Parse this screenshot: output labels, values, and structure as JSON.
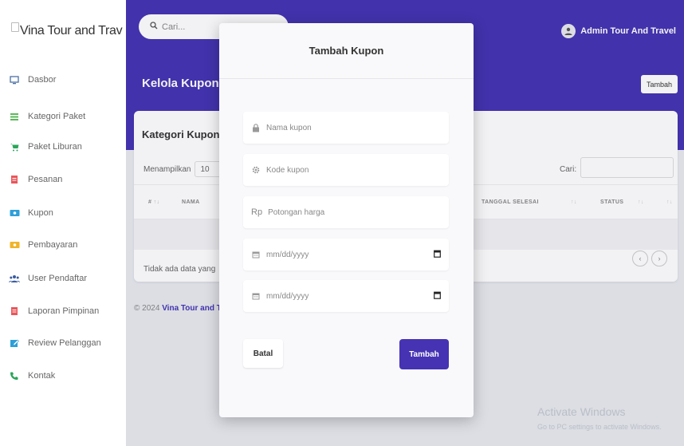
{
  "brand": {
    "name": "Vina Tour and Trav"
  },
  "sidebar": {
    "items": [
      {
        "label": "Dasbor",
        "icon": "monitor-icon"
      },
      {
        "label": "Kategori Paket",
        "icon": "list-icon"
      },
      {
        "label": "Paket Liburan",
        "icon": "cart-icon"
      },
      {
        "label": "Pesanan",
        "icon": "document-icon"
      },
      {
        "label": "Kupon",
        "icon": "ticket-icon"
      },
      {
        "label": "Pembayaran",
        "icon": "money-icon"
      },
      {
        "label": "User Pendaftar",
        "icon": "users-icon"
      },
      {
        "label": "Laporan Pimpinan",
        "icon": "report-icon"
      },
      {
        "label": "Review Pelanggan",
        "icon": "edit-icon"
      },
      {
        "label": "Kontak",
        "icon": "phone-icon"
      }
    ]
  },
  "topbar": {
    "search_placeholder": "Cari...",
    "admin_name": "Admin Tour And Travel"
  },
  "page": {
    "title": "Kelola Kupon B",
    "add_button": "Tambah"
  },
  "card": {
    "title": "Kategori Kupon",
    "show_label": "Menampilkan",
    "show_value": "10",
    "search_label": "Cari:",
    "columns": [
      "#",
      "NAMA",
      "TANGGAL SELESAI",
      "STATUS"
    ],
    "empty_text": "Tidak ada data yang",
    "pager": {
      "prev": "‹",
      "next": "›"
    }
  },
  "footer": {
    "copyright": "© 2024",
    "brand": "Vina Tour and T"
  },
  "modal": {
    "title": "Tambah Kupon",
    "fields": {
      "name_placeholder": "Nama kupon",
      "code_placeholder": "Kode kupon",
      "discount_prefix": "Rp",
      "discount_placeholder": "Potongan harga",
      "start_date_placeholder": "mm/dd/yyyy",
      "end_date_placeholder": "mm/dd/yyyy"
    },
    "cancel_label": "Batal",
    "submit_label": "Tambah"
  },
  "watermark": {
    "line1": "Activate Windows",
    "line2": "Go to PC settings to activate Windows."
  },
  "colors": {
    "primary": "#4533b3",
    "background": "#e8eaef"
  }
}
